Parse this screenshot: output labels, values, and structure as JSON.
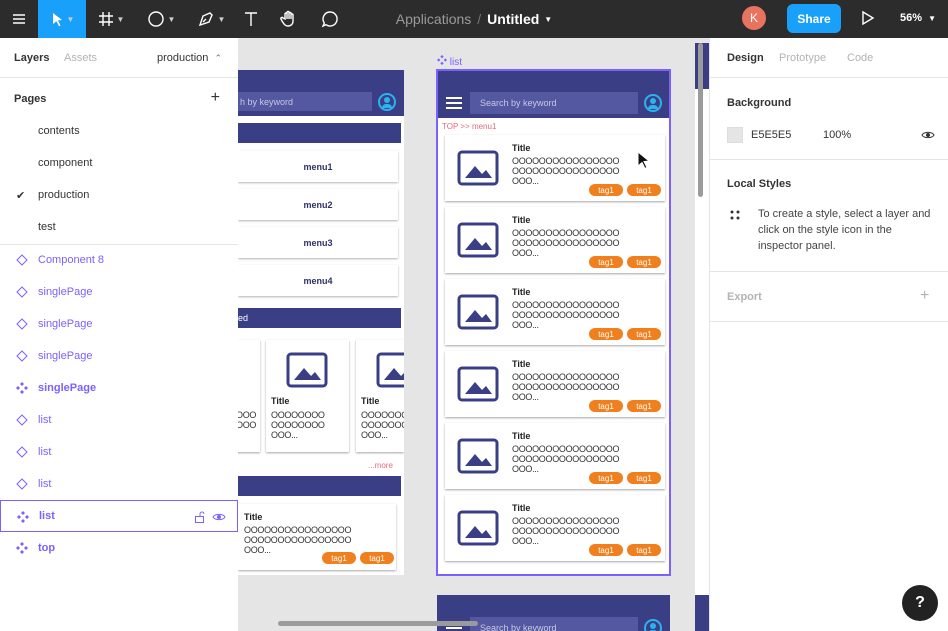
{
  "toolbar": {
    "project": "Applications",
    "separator": "/",
    "file_name": "Untitled",
    "avatar_initial": "K",
    "share_label": "Share",
    "zoom": "56%"
  },
  "left_panel": {
    "tabs": [
      "Layers",
      "Assets"
    ],
    "page_selector": "production",
    "pages_heading": "Pages",
    "pages": [
      "contents",
      "component",
      "production",
      "test"
    ],
    "current_page": "production",
    "layers": [
      {
        "name": "Component 8",
        "type": "component"
      },
      {
        "name": "singlePage",
        "type": "component"
      },
      {
        "name": "singlePage",
        "type": "component"
      },
      {
        "name": "singlePage",
        "type": "component"
      },
      {
        "name": "singlePage",
        "type": "main"
      },
      {
        "name": "list",
        "type": "component"
      },
      {
        "name": "list",
        "type": "component"
      },
      {
        "name": "list",
        "type": "component"
      },
      {
        "name": "list",
        "type": "main",
        "selected": true
      },
      {
        "name": "top",
        "type": "main"
      }
    ]
  },
  "canvas": {
    "frame_label": "list",
    "search_placeholder": "Search by keyword",
    "left_search_partial": "h by keyword",
    "breadcrumb": "TOP >> menu1",
    "card_title": "Title",
    "card_body_line1": "OOOOOOOOOOOOOOOO",
    "card_body_line2": "OOOOOOOOOOOOOOOO",
    "card_body_line3": "OOO...",
    "grid_body_line1": "OOOOOOOO",
    "grid_body_line2": "OOOOOOOO",
    "grid_body_line3": "OOO...",
    "tag": "tag1",
    "menus": [
      "menu1",
      "menu2",
      "menu3",
      "menu4"
    ],
    "bar_partial": "ed",
    "more": "...more"
  },
  "right_panel": {
    "tabs": [
      "Design",
      "Prototype",
      "Code"
    ],
    "background_heading": "Background",
    "bg_hex": "E5E5E5",
    "bg_opacity": "100%",
    "local_styles_heading": "Local Styles",
    "local_styles_hint": "To create a style, select a layer and click on the style icon in the inspector panel.",
    "export_heading": "Export"
  },
  "help_label": "?",
  "colors": {
    "accent": "#18a0fb",
    "selection": "#7b61ff",
    "frame_header": "#3a3f85",
    "tag": "#f07f1e"
  }
}
